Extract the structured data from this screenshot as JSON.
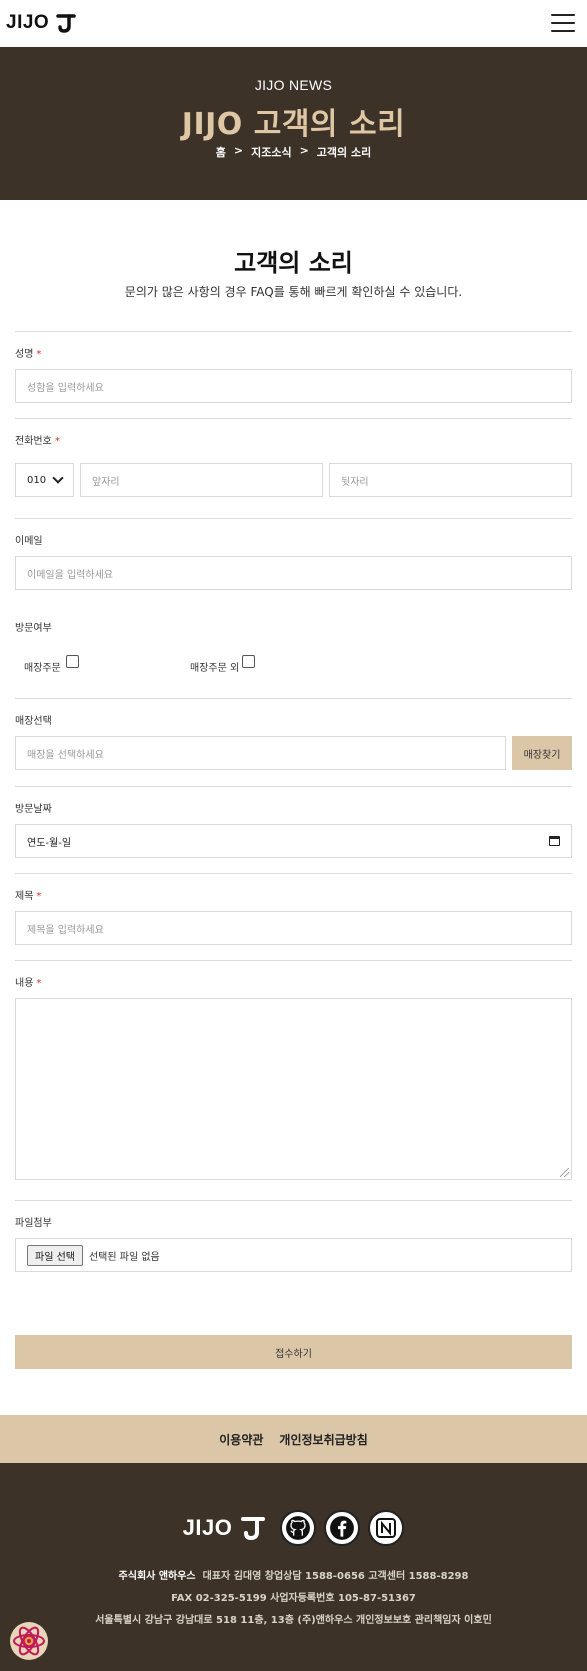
{
  "header": {
    "logo_text": "JIJO"
  },
  "hero": {
    "eyebrow": "JIJO NEWS",
    "title": "JIJO 고객의 소리",
    "breadcrumb": [
      "홈",
      ">",
      "지조소식",
      ">",
      "고객의 소리"
    ]
  },
  "section": {
    "title": "고객의 소리",
    "subtitle": "문의가 많은 사항의 경우 FAQ를 통해 빠르게 확인하실 수 있습니다."
  },
  "form": {
    "name": {
      "label": "성명",
      "required_mark": "*",
      "placeholder": "성함을 입력하세요"
    },
    "phone": {
      "label": "전화번호",
      "required_mark": "*",
      "prefix": "010",
      "middle_placeholder": "앞자리",
      "last_placeholder": "뒷자리"
    },
    "email": {
      "label": "이메일",
      "placeholder": "이메일을 입력하세요"
    },
    "visit": {
      "label": "방문여부",
      "option1": "매장주문",
      "option2": "매장주문 외"
    },
    "store": {
      "label": "매장선택",
      "placeholder": "매장을 선택하세요",
      "button": "매장찾기"
    },
    "visit_date": {
      "label": "방문날짜",
      "placeholder": "연도-월-일"
    },
    "subject": {
      "label": "제목",
      "required_mark": "*",
      "placeholder": "제목을 입력하세요"
    },
    "content": {
      "label": "내용",
      "required_mark": "*"
    },
    "file": {
      "label": "파일첨부",
      "button": "파일 선택",
      "status": "선택된 파일 없음"
    },
    "submit": "접수하기"
  },
  "footer": {
    "links": [
      "이용약관",
      "개인정보취급방침"
    ],
    "logo_text": "JIJO",
    "company": "주식회사 앤하우스",
    "line1_rest": "대표자 김대영  창업상담 1588-0656  고객센터 1588-8298",
    "line2": "FAX 02-325-5199  사업자등록번호 105-87-51367",
    "line3": "서울특별시 강남구 강남대로 518 11층, 13층 (주)앤하우스  개인정보보호 관리책임자 이호민",
    "social_icons": [
      "github-icon",
      "facebook-icon",
      "notion-icon"
    ]
  },
  "colors": {
    "brand_dark": "#3c3227",
    "brand_beige": "#dbc7a8",
    "hero_title": "#dfc7a6",
    "required": "#d0312d"
  }
}
